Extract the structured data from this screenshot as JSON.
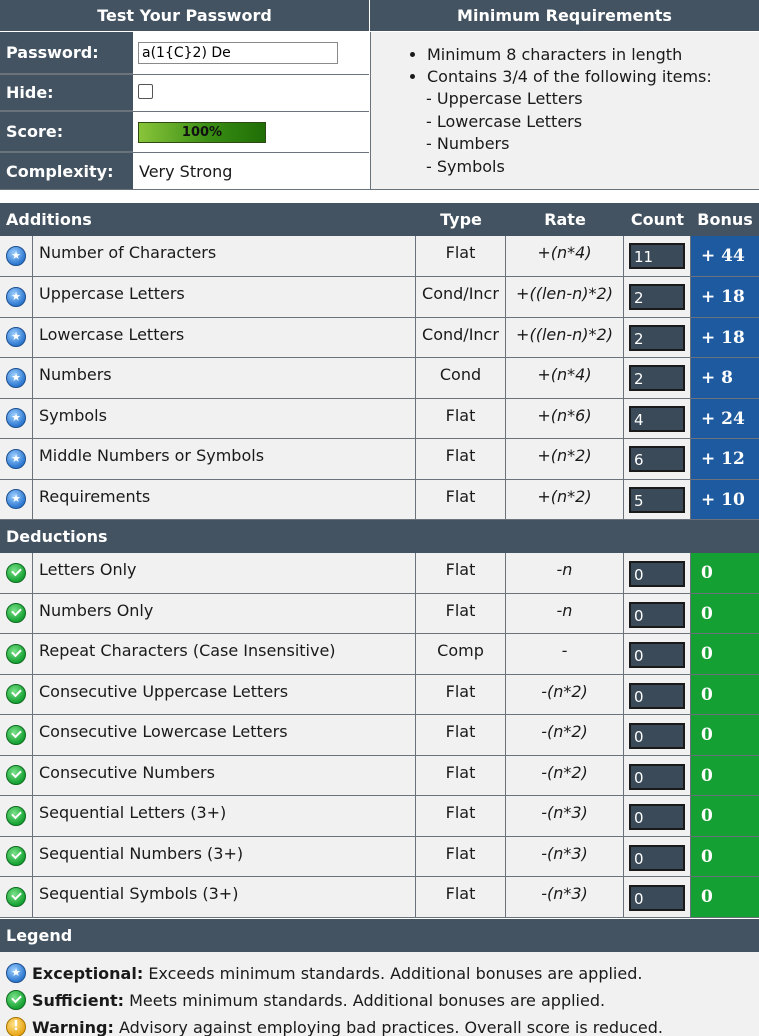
{
  "top": {
    "test_header": "Test Your Password",
    "min_header": "Minimum Requirements",
    "password_label": "Password:",
    "password_value": "a(1{C}2) De",
    "hide_label": "Hide:",
    "score_label": "Score:",
    "score_value": "100%",
    "score_fraction": 1.0,
    "complexity_label": "Complexity:",
    "complexity_value": "Very Strong",
    "requirements": [
      "Minimum 8 characters in length",
      "Contains 3/4 of the following items:"
    ],
    "sub_requirements": [
      "- Uppercase Letters",
      "- Lowercase Letters",
      "- Numbers",
      "- Symbols"
    ]
  },
  "table": {
    "additions_label": "Additions",
    "type_label": "Type",
    "rate_label": "Rate",
    "count_label": "Count",
    "bonus_label": "Bonus",
    "additions": [
      {
        "name": "Number of Characters",
        "type": "Flat",
        "rate": "+(n*4)",
        "count": "11",
        "bonus": "+ 44"
      },
      {
        "name": "Uppercase Letters",
        "type": "Cond/Incr",
        "rate": "+((len-n)*2)",
        "count": "2",
        "bonus": "+ 18"
      },
      {
        "name": "Lowercase Letters",
        "type": "Cond/Incr",
        "rate": "+((len-n)*2)",
        "count": "2",
        "bonus": "+ 18"
      },
      {
        "name": "Numbers",
        "type": "Cond",
        "rate": "+(n*4)",
        "count": "2",
        "bonus": "+ 8"
      },
      {
        "name": "Symbols",
        "type": "Flat",
        "rate": "+(n*6)",
        "count": "4",
        "bonus": "+ 24"
      },
      {
        "name": "Middle Numbers or Symbols",
        "type": "Flat",
        "rate": "+(n*2)",
        "count": "6",
        "bonus": "+ 12"
      },
      {
        "name": "Requirements",
        "type": "Flat",
        "rate": "+(n*2)",
        "count": "5",
        "bonus": "+ 10"
      }
    ],
    "deductions_label": "Deductions",
    "deductions": [
      {
        "name": "Letters Only",
        "type": "Flat",
        "rate": "-n",
        "count": "0",
        "bonus": "0"
      },
      {
        "name": "Numbers Only",
        "type": "Flat",
        "rate": "-n",
        "count": "0",
        "bonus": "0"
      },
      {
        "name": "Repeat Characters (Case Insensitive)",
        "type": "Comp",
        "rate": "-",
        "count": "0",
        "bonus": "0"
      },
      {
        "name": "Consecutive Uppercase Letters",
        "type": "Flat",
        "rate": "-(n*2)",
        "count": "0",
        "bonus": "0"
      },
      {
        "name": "Consecutive Lowercase Letters",
        "type": "Flat",
        "rate": "-(n*2)",
        "count": "0",
        "bonus": "0"
      },
      {
        "name": "Consecutive Numbers",
        "type": "Flat",
        "rate": "-(n*2)",
        "count": "0",
        "bonus": "0"
      },
      {
        "name": "Sequential Letters (3+)",
        "type": "Flat",
        "rate": "-(n*3)",
        "count": "0",
        "bonus": "0"
      },
      {
        "name": "Sequential Numbers (3+)",
        "type": "Flat",
        "rate": "-(n*3)",
        "count": "0",
        "bonus": "0"
      },
      {
        "name": "Sequential Symbols (3+)",
        "type": "Flat",
        "rate": "-(n*3)",
        "count": "0",
        "bonus": "0"
      }
    ]
  },
  "legend": {
    "header": "Legend",
    "items": [
      {
        "icon": "exceptional-icon",
        "term": "Exceptional:",
        "desc": " Exceeds minimum standards. Additional bonuses are applied."
      },
      {
        "icon": "sufficient-icon",
        "term": "Sufficient:",
        "desc": " Meets minimum standards. Additional bonuses are applied."
      },
      {
        "icon": "warning-icon",
        "term": "Warning:",
        "desc": " Advisory against employing bad practices. Overall score is reduced."
      }
    ]
  },
  "colors": {
    "header": "#435361",
    "row": "#f1f1f1",
    "bonus_blue": "#1e5aa0",
    "bonus_green": "#14a032",
    "count_box": "#3a4a58"
  }
}
